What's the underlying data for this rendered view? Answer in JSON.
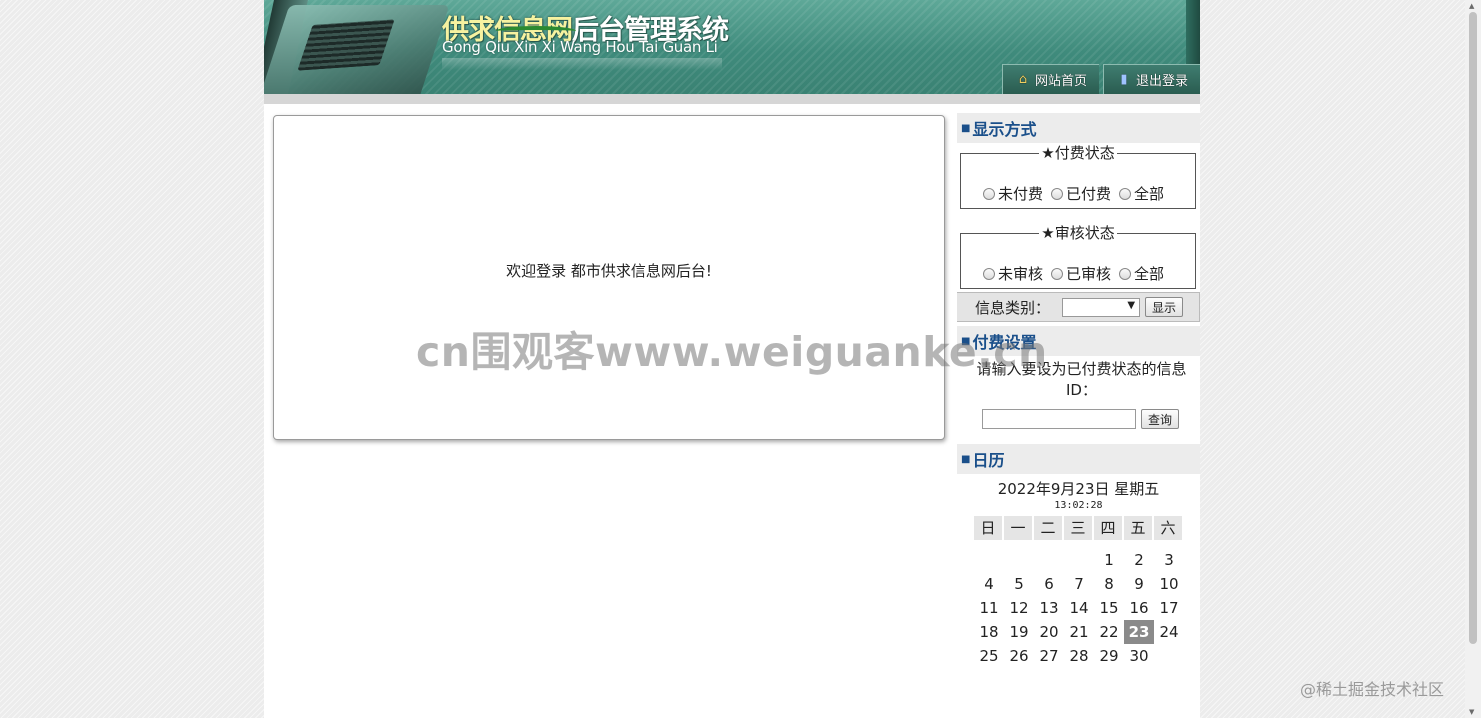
{
  "header": {
    "title_part1": "供求信息网",
    "title_part2": "后台管理系统",
    "subtitle": "Gong Qiu Xin Xi Wang Hou Tai Guan Li",
    "nav": [
      {
        "label": "网站首页",
        "icon": "home-icon"
      },
      {
        "label": "退出登录",
        "icon": "exit-icon"
      }
    ]
  },
  "main": {
    "welcome": "欢迎登录 都市供求信息网后台!"
  },
  "sidebar": {
    "display": {
      "heading": "显示方式",
      "payment": {
        "legend": "★付费状态",
        "options": [
          "未付费",
          "已付费",
          "全部"
        ]
      },
      "review": {
        "legend": "★审核状态",
        "options": [
          "未审核",
          "已审核",
          "全部"
        ]
      },
      "category_label": "信息类别：",
      "category_value": "",
      "show_button": "显示"
    },
    "pay_setting": {
      "heading": "付费设置",
      "description": "请输入要设为已付费状态的信息ID：",
      "input_value": "",
      "query_button": "查询"
    },
    "calendar": {
      "heading": "日历",
      "date": "2022年9月23日 星期五",
      "time": "13:02:28",
      "weekdays": [
        "日",
        "一",
        "二",
        "三",
        "四",
        "五",
        "六"
      ],
      "weeks": [
        [
          "",
          "",
          "",
          "",
          "1",
          "2",
          "3"
        ],
        [
          "4",
          "5",
          "6",
          "7",
          "8",
          "9",
          "10"
        ],
        [
          "11",
          "12",
          "13",
          "14",
          "15",
          "16",
          "17"
        ],
        [
          "18",
          "19",
          "20",
          "21",
          "22",
          "23",
          "24"
        ],
        [
          "25",
          "26",
          "27",
          "28",
          "29",
          "30",
          ""
        ]
      ],
      "today": "23"
    }
  },
  "watermarks": {
    "center": "cn围观客www.weiguanke.cn",
    "corner": "@稀土掘金技术社区"
  }
}
